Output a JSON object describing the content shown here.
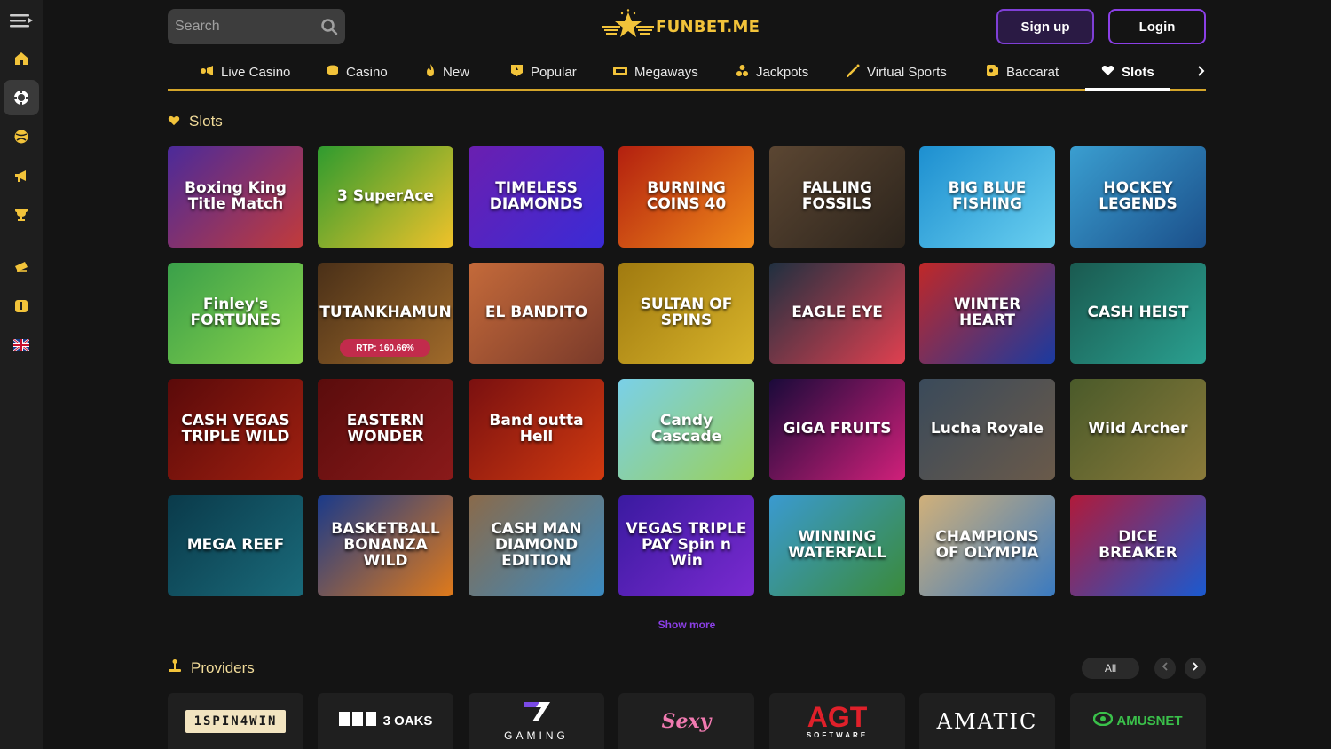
{
  "sidebar": {
    "items": [
      {
        "icon": "menu-toggle-icon"
      },
      {
        "icon": "home-icon"
      },
      {
        "icon": "casino-chip-icon"
      },
      {
        "icon": "sports-ball-icon"
      },
      {
        "icon": "promotions-megaphone-icon"
      },
      {
        "icon": "trophy-icon"
      },
      {
        "icon": "tickets-icon"
      },
      {
        "icon": "info-icon"
      },
      {
        "icon": "uk-flag-icon"
      }
    ]
  },
  "header": {
    "search_placeholder": "Search",
    "logo_text": "FUNBET.ME",
    "signup_label": "Sign up",
    "login_label": "Login"
  },
  "categories": [
    {
      "label": "Live Casino",
      "icon": "live-casino-icon"
    },
    {
      "label": "Casino",
      "icon": "casino-icon"
    },
    {
      "label": "New",
      "icon": "fire-icon"
    },
    {
      "label": "Popular",
      "icon": "popular-icon"
    },
    {
      "label": "Megaways",
      "icon": "megaways-icon"
    },
    {
      "label": "Jackpots",
      "icon": "jackpots-icon"
    },
    {
      "label": "Virtual Sports",
      "icon": "virtual-sports-icon"
    },
    {
      "label": "Baccarat",
      "icon": "baccarat-icon"
    },
    {
      "label": "Slots",
      "icon": "heart-icon",
      "active": true
    }
  ],
  "slots_section": {
    "title": "Slots",
    "games": [
      {
        "name": "Boxing King Title Match",
        "bg": "#4b2a9a",
        "bg2": "#c23b3b"
      },
      {
        "name": "3 SuperAce",
        "bg": "#2f9b2f",
        "bg2": "#f0c22a"
      },
      {
        "name": "TIMELESS DIAMONDS",
        "bg": "#6a1fb0",
        "bg2": "#3a2bd6"
      },
      {
        "name": "BURNING COINS 40",
        "bg": "#b3200f",
        "bg2": "#f08a1a"
      },
      {
        "name": "FALLING FOSSILS",
        "bg": "#5b4632",
        "bg2": "#2c241c"
      },
      {
        "name": "BIG BLUE FISHING",
        "bg": "#1d8fd0",
        "bg2": "#6ad0f0"
      },
      {
        "name": "HOCKEY LEGENDS",
        "bg": "#3a9ed0",
        "bg2": "#1b4f8a"
      },
      {
        "name": "Finley's FORTUNES",
        "bg": "#3aa04a",
        "bg2": "#8ad24a"
      },
      {
        "name": "TUTANKHAMUN",
        "bg": "#4a3018",
        "bg2": "#a06a2a",
        "rtp": "RTP: 160.66%"
      },
      {
        "name": "EL BANDITO",
        "bg": "#c46a3a",
        "bg2": "#7a3a2a"
      },
      {
        "name": "SULTAN OF SPINS",
        "bg": "#a07a10",
        "bg2": "#d8b42a"
      },
      {
        "name": "EAGLE EYE",
        "bg": "#203040",
        "bg2": "#e04050"
      },
      {
        "name": "WINTER HEART",
        "bg": "#c02828",
        "bg2": "#1a3aa0"
      },
      {
        "name": "CASH HEIST",
        "bg": "#1a5a50",
        "bg2": "#2aa090"
      },
      {
        "name": "CASH VEGAS TRIPLE WILD",
        "bg": "#5a0a0a",
        "bg2": "#a02010"
      },
      {
        "name": "EASTERN WONDER",
        "bg": "#5a0c0c",
        "bg2": "#8a1a1a"
      },
      {
        "name": "Band outta Hell",
        "bg": "#7a1010",
        "bg2": "#d03a10"
      },
      {
        "name": "Candy Cascade",
        "bg": "#7ad0e8",
        "bg2": "#9ad05a"
      },
      {
        "name": "GIGA FRUITS",
        "bg": "#1a0a3a",
        "bg2": "#d0207a"
      },
      {
        "name": "Lucha Royale",
        "bg": "#3a4a5a",
        "bg2": "#6a5a4a"
      },
      {
        "name": "Wild Archer",
        "bg": "#4a5a2a",
        "bg2": "#8a7a3a"
      },
      {
        "name": "MEGA REEF",
        "bg": "#0a3a4a",
        "bg2": "#1a6a7a"
      },
      {
        "name": "BASKETBALL BONANZA WILD",
        "bg": "#1a3a8a",
        "bg2": "#e07a1a"
      },
      {
        "name": "CASH MAN DIAMOND EDITION",
        "bg": "#8a6a4a",
        "bg2": "#3a8ac0"
      },
      {
        "name": "VEGAS TRIPLE PAY Spin n Win",
        "bg": "#3a1aa0",
        "bg2": "#7a2ad0"
      },
      {
        "name": "WINNING WATERFALL",
        "bg": "#3a9ad0",
        "bg2": "#3a8a3a"
      },
      {
        "name": "CHAMPIONS OF OLYMPIA",
        "bg": "#d0b07a",
        "bg2": "#3a7ac0"
      },
      {
        "name": "DICE BREAKER",
        "bg": "#b01a3a",
        "bg2": "#1a5ad0"
      }
    ],
    "show_more_label": "Show more"
  },
  "providers_section": {
    "title": "Providers",
    "all_label": "All",
    "providers": [
      {
        "name": "1SPIN4WIN",
        "color": "#f2c33a"
      },
      {
        "name": "3 OAKS",
        "color": "#ffffff"
      },
      {
        "name": "GAMING",
        "color": "#ffffff"
      },
      {
        "name": "Sexy",
        "color": "#f07ab0"
      },
      {
        "name": "AGT",
        "color": "#e0202a"
      },
      {
        "name": "AMATIC",
        "color": "#ffffff"
      },
      {
        "name": "AMUSNET",
        "color": "#3ac04a"
      }
    ]
  },
  "colors": {
    "accent_gold": "#d4a52a",
    "accent_purple": "#8b3fe6",
    "background": "#141414"
  }
}
